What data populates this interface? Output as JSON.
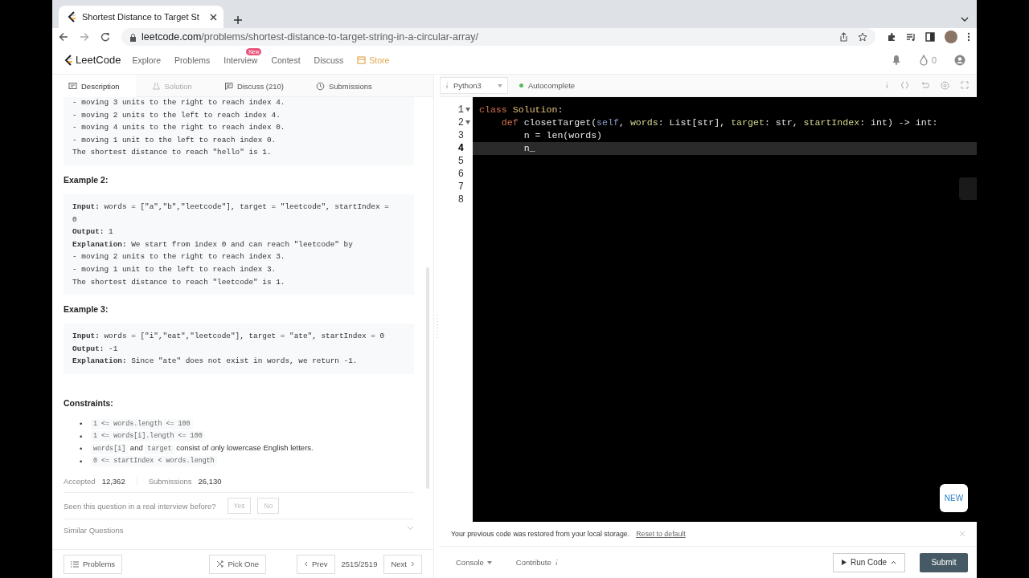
{
  "browser": {
    "tab_title": "Shortest Distance to Target St",
    "url_domain": "leetcode.com",
    "url_path": "/problems/shortest-distance-to-target-string-in-a-circular-array/"
  },
  "nav": {
    "logo": "LeetCode",
    "links": [
      {
        "label": "Explore",
        "kind": "plain"
      },
      {
        "label": "Problems",
        "kind": "plain"
      },
      {
        "label": "Interview",
        "kind": "plain",
        "badge": "New"
      },
      {
        "label": "Contest",
        "kind": "plain"
      },
      {
        "label": "Discuss",
        "kind": "plain"
      },
      {
        "label": "Store",
        "kind": "store"
      }
    ],
    "streak": "0"
  },
  "tabs": [
    {
      "label": "Description",
      "selected": true,
      "disabled": false
    },
    {
      "label": "Solution",
      "selected": false,
      "disabled": true
    },
    {
      "label": "Discuss (210)",
      "selected": false,
      "disabled": false
    },
    {
      "label": "Submissions",
      "selected": false,
      "disabled": false
    }
  ],
  "editor_toolbar": {
    "language": "Python3",
    "autocomplete": "Autocomplete"
  },
  "description": [
    {
      "kind": "pre",
      "lines": [
        "- moving 3 units to the right to reach index 4.",
        "- moving 2 units to the left to reach index 4.",
        "- moving 4 units to the right to reach index 0.",
        "- moving 1 unit to the left to reach index 0.",
        "The shortest distance to reach \"hello\" is 1."
      ]
    },
    {
      "kind": "heading",
      "text": "Example 2:"
    },
    {
      "kind": "pre",
      "lines": [
        "**Input:** words = [\"a\",\"b\",\"leetcode\"], target = \"leetcode\", startIndex =",
        "0",
        "**Output:** 1",
        "**Explanation:** We start from index 0 and can reach \"leetcode\" by",
        "- moving 2 units to the right to reach index 3.",
        "- moving 1 unit to the left to reach index 3.",
        "The shortest distance to reach \"leetcode\" is 1."
      ]
    },
    {
      "kind": "heading",
      "text": "Example 3:"
    },
    {
      "kind": "pre",
      "lines": [
        "**Input:** words = [\"i\",\"eat\",\"leetcode\"], target = \"ate\", startIndex = 0",
        "**Output:** -1",
        "**Explanation:** Since \"ate\" does not exist in words, we return -1."
      ]
    },
    {
      "kind": "heading",
      "text": "Constraints:"
    },
    {
      "kind": "list",
      "bullet": "•",
      "items": [
        [
          {
            "kind": "code",
            "text": "1 <= words.length <= 100"
          }
        ],
        [
          {
            "kind": "code",
            "text": "1 <= words[i].length <= 100"
          }
        ],
        [
          {
            "kind": "code",
            "text": "words[i]"
          },
          {
            "kind": "text",
            "text": "and"
          },
          {
            "kind": "code",
            "text": "target"
          },
          {
            "kind": "text",
            "text": "consist of only lowercase English letters."
          }
        ],
        [
          {
            "kind": "code",
            "text": "0 <= startIndex < words.length"
          }
        ]
      ]
    }
  ],
  "stats": [
    {
      "label": "Accepted",
      "value": "12,362"
    },
    {
      "label": "Submissions",
      "value": "26,130"
    }
  ],
  "interview_question": {
    "text": "Seen this question in a real interview before?",
    "buttons": [
      "Yes",
      "No"
    ]
  },
  "similar_questions": "Similar Questions",
  "code": [
    {
      "number": "1",
      "fold": true,
      "current": false,
      "tokens": [
        {
          "kind": "keyword",
          "text": "class"
        },
        {
          "kind": "name",
          "text": " Solution"
        },
        {
          "kind": "plain",
          "text": ":"
        }
      ]
    },
    {
      "number": "2",
      "fold": true,
      "current": false,
      "tokens": [
        {
          "kind": "keyword",
          "text": "    def"
        },
        {
          "kind": "plain",
          "text": " closetTarget("
        },
        {
          "kind": "self",
          "text": "self"
        },
        {
          "kind": "plain",
          "text": ", "
        },
        {
          "kind": "param",
          "text": "words"
        },
        {
          "kind": "plain",
          "text": ": List[str], "
        },
        {
          "kind": "param",
          "text": "target"
        },
        {
          "kind": "plain",
          "text": ": str, "
        },
        {
          "kind": "param",
          "text": "startIndex"
        },
        {
          "kind": "plain",
          "text": ": int) -> int:"
        }
      ]
    },
    {
      "number": "3",
      "fold": false,
      "current": false,
      "tokens": [
        {
          "kind": "plain",
          "text": "        n = len(words)"
        }
      ]
    },
    {
      "number": "4",
      "fold": false,
      "current": true,
      "tokens": [
        {
          "kind": "plain",
          "text": "        n_"
        }
      ]
    },
    {
      "number": "5",
      "fold": false,
      "current": false
    },
    {
      "number": "6",
      "fold": false,
      "current": false
    },
    {
      "number": "7",
      "fold": false,
      "current": false
    },
    {
      "number": "8",
      "fold": false,
      "current": false
    }
  ],
  "new_badge": "NEW",
  "notice": {
    "text": "Your previous code was restored from your local storage.",
    "link": "Reset to default"
  },
  "bottom_left": {
    "problems": "Problems",
    "pick_one": "Pick One",
    "prev": "Prev",
    "position": "2515/2519",
    "next": "Next"
  },
  "bottom_right": {
    "console": "Console",
    "contribute": "Contribute",
    "run": "Run Code",
    "submit": "Submit"
  }
}
